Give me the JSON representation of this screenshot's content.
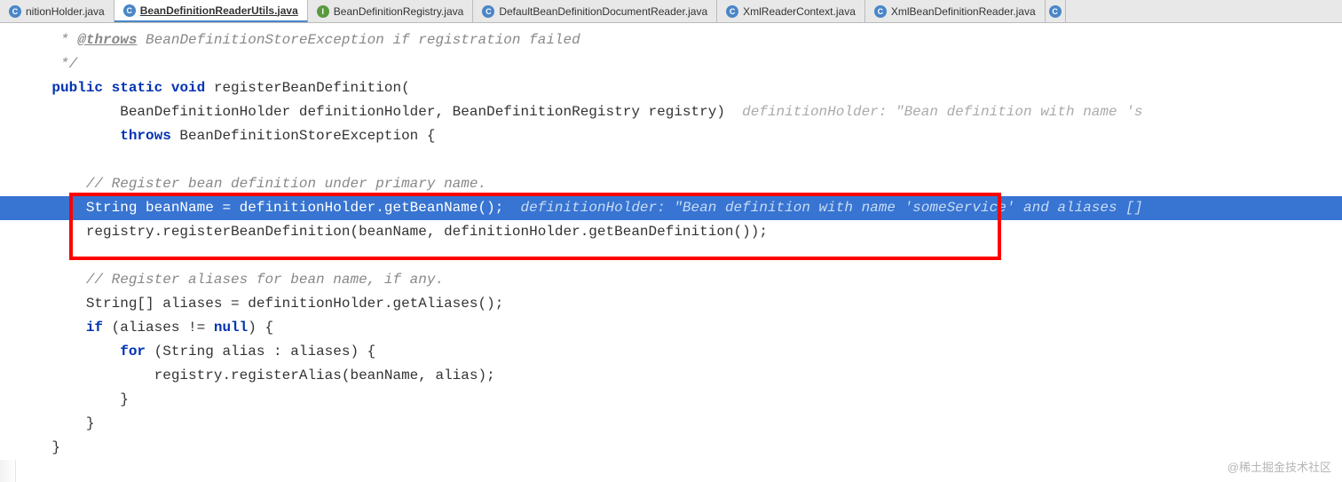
{
  "tabs": [
    {
      "label": "nitionHolder.java",
      "iconType": "java-class",
      "iconLetter": "C",
      "active": false,
      "bold": false
    },
    {
      "label": "BeanDefinitionReaderUtils.java",
      "iconType": "java-class",
      "iconLetter": "C",
      "active": true,
      "bold": true
    },
    {
      "label": "BeanDefinitionRegistry.java",
      "iconType": "java-interface",
      "iconLetter": "I",
      "active": false,
      "bold": false
    },
    {
      "label": "DefaultBeanDefinitionDocumentReader.java",
      "iconType": "java-class",
      "iconLetter": "C",
      "active": false,
      "bold": false
    },
    {
      "label": "XmlReaderContext.java",
      "iconType": "java-class",
      "iconLetter": "C",
      "active": false,
      "bold": false
    },
    {
      "label": "XmlBeanDefinitionReader.java",
      "iconType": "java-class",
      "iconLetter": "C",
      "active": false,
      "bold": false
    }
  ],
  "code": {
    "l1_a": " * ",
    "l1_b": "@throws",
    "l1_c": " BeanDefinitionStoreException ",
    "l1_d": "if registration failed",
    "l2": " */",
    "l3_a": "public",
    "l3_b": "static",
    "l3_c": "void",
    "l3_d": " registerBeanDefinition(",
    "l4_a": "        BeanDefinitionHolder definitionHolder, BeanDefinitionRegistry registry)  ",
    "l4_hint": "definitionHolder: \"Bean definition with name 's",
    "l5_a": "        ",
    "l5_b": "throws",
    "l5_c": " BeanDefinitionStoreException {",
    "l7": "    // Register bean definition under primary name.",
    "l8_a": "    String beanName = definitionHolder.getBeanName();  ",
    "l8_hint": "definitionHolder: \"Bean definition with name 'someService' and aliases []",
    "l9": "    registry.registerBeanDefinition(beanName, definitionHolder.getBeanDefinition());",
    "l11": "    // Register aliases for bean name, if any.",
    "l12": "    String[] aliases = definitionHolder.getAliases();",
    "l13_a": "    ",
    "l13_b": "if",
    "l13_c": " (aliases != ",
    "l13_d": "null",
    "l13_e": ") {",
    "l14_a": "        ",
    "l14_b": "for",
    "l14_c": " (String alias : aliases) {",
    "l15": "            registry.registerAlias(beanName, alias);",
    "l16": "        }",
    "l17": "    }",
    "l18": "}"
  },
  "watermark": "@稀土掘金技术社区"
}
